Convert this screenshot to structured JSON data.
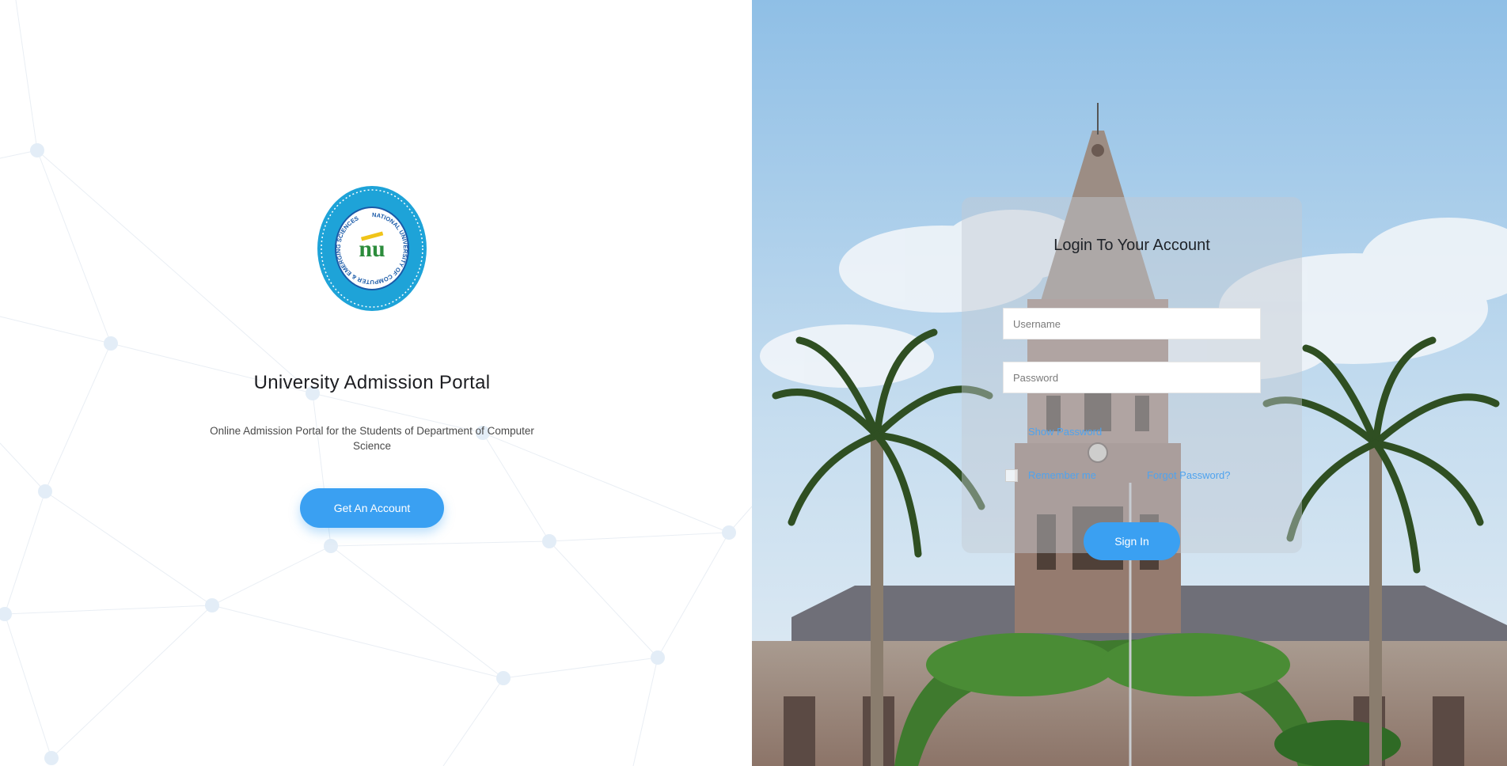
{
  "left": {
    "title": "University Admission Portal",
    "description": "Online Admission Portal for the Students of Department of Computer Science",
    "get_account_label": "Get An Account",
    "logo": {
      "center_text": "nu",
      "ring_text": "NATIONAL UNIVERSITY OF COMPUTER & EMERGING SCIENCES"
    }
  },
  "login": {
    "title": "Login To Your Account",
    "username_placeholder": "Username",
    "password_placeholder": "Password",
    "show_password_label": "Show Password",
    "remember_label": "Remember me",
    "forgot_label": "Forgot Password?",
    "sign_in_label": "Sign In"
  },
  "colors": {
    "accent": "#3aa0f2",
    "link": "#4fa3ee",
    "network": "#e8f1f9"
  }
}
